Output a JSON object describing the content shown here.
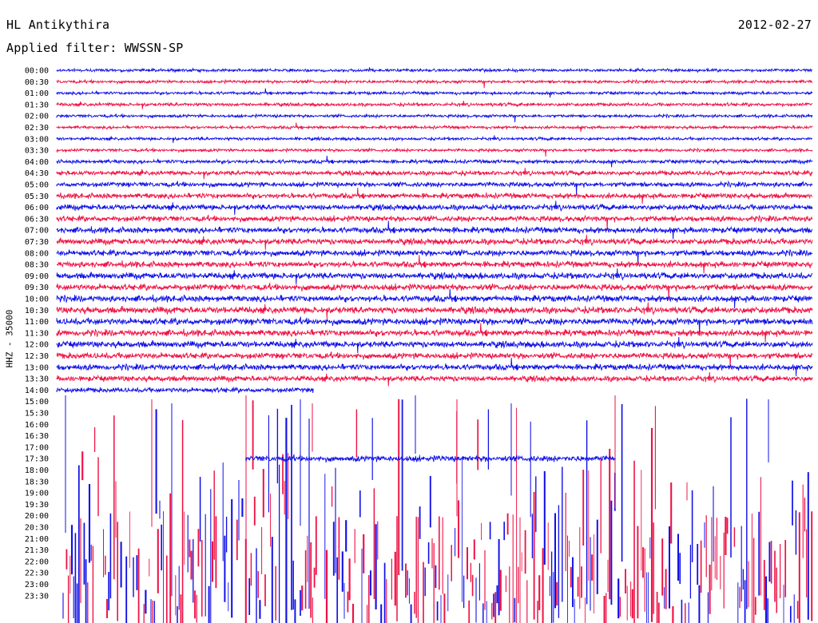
{
  "header": {
    "station": "HL Antikythira",
    "date": "2012-02-27",
    "filter": "Applied filter: WWSSN-SP"
  },
  "chart_data": {
    "type": "line",
    "title": "HL Antikythira",
    "ylabel": "HHZ - 35000",
    "xlabel": "",
    "colors": [
      "#1010e8",
      "#ee1144"
    ],
    "row_labels": [
      "00:00",
      "00:30",
      "01:00",
      "01:30",
      "02:00",
      "02:30",
      "03:00",
      "03:30",
      "04:00",
      "04:30",
      "05:00",
      "05:30",
      "06:00",
      "06:30",
      "07:00",
      "07:30",
      "08:00",
      "08:30",
      "09:00",
      "09:30",
      "10:00",
      "10:30",
      "11:00",
      "11:30",
      "12:00",
      "12:30",
      "13:00",
      "13:30",
      "14:00",
      "15:00",
      "15:30",
      "16:00",
      "16:30",
      "17:00",
      "17:30",
      "18:00",
      "18:30",
      "19:00",
      "19:30",
      "20:00",
      "20:30",
      "21:00",
      "21:30",
      "22:00",
      "22:30",
      "23:00",
      "23:30"
    ],
    "row_amplitude": [
      0.8,
      0.8,
      0.8,
      0.9,
      0.8,
      0.8,
      0.8,
      0.8,
      1.0,
      1.2,
      1.3,
      1.4,
      1.5,
      1.5,
      1.6,
      1.6,
      1.6,
      1.6,
      1.7,
      1.7,
      1.7,
      1.8,
      1.8,
      1.7,
      1.7,
      1.6,
      1.6,
      1.5,
      1.3,
      0,
      0,
      0,
      0,
      0,
      1.6,
      0,
      0,
      0,
      0,
      0,
      0,
      0,
      0,
      0,
      0,
      0,
      0
    ],
    "row_extent": [
      1,
      1,
      1,
      1,
      1,
      1,
      1,
      1,
      1,
      1,
      1,
      1,
      1,
      1,
      1,
      1,
      1,
      1,
      1,
      1,
      1,
      1,
      1,
      1,
      1,
      1,
      1,
      1,
      0.34,
      0,
      0,
      0,
      0,
      0,
      0.49,
      0,
      0,
      0,
      0,
      0,
      0,
      0,
      0,
      0,
      0,
      0,
      0
    ],
    "row_start": [
      0,
      0,
      0,
      0,
      0,
      0,
      0,
      0,
      0,
      0,
      0,
      0,
      0,
      0,
      0,
      0,
      0,
      0,
      0,
      0,
      0,
      0,
      0,
      0,
      0,
      0,
      0,
      0,
      0,
      0,
      0,
      0,
      0,
      0,
      0.25,
      0,
      0,
      0,
      0,
      0,
      0,
      0,
      0,
      0,
      0,
      0,
      0
    ],
    "spike_region_start_label": "15:00",
    "spike_density": 0.75
  }
}
